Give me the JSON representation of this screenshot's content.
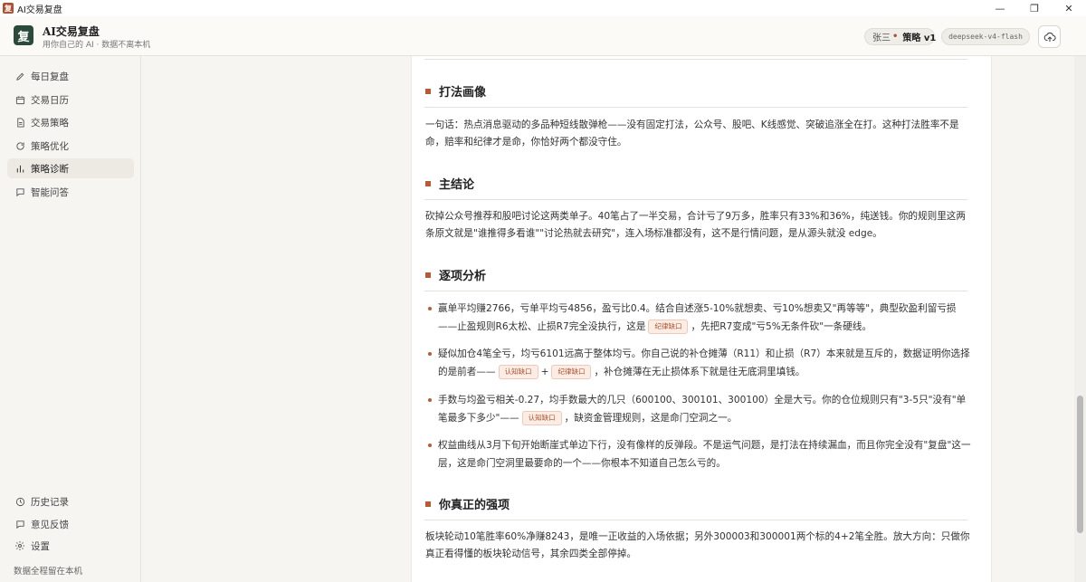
{
  "window": {
    "title": "AI交易复盘",
    "app_icon_glyph": "复",
    "controls": {
      "minimize": "—",
      "maximize": "❐",
      "close": "✕"
    }
  },
  "header": {
    "logo_text": "复",
    "brand_title": "AI交易复盘",
    "brand_subtitle": "用你自己的 AI · 数据不离本机",
    "user_name": "张三",
    "separator": "•",
    "strategy": "策略 v1",
    "model": "deepseek-v4-flash",
    "colors": {
      "logo_bg": "#2c4a3c",
      "accent": "#b85a36"
    }
  },
  "sidebar": {
    "items": [
      {
        "label": "每日复盘",
        "icon": "pencil-icon"
      },
      {
        "label": "交易日历",
        "icon": "calendar-icon"
      },
      {
        "label": "交易策略",
        "icon": "document-icon"
      },
      {
        "label": "策略优化",
        "icon": "refresh-icon"
      },
      {
        "label": "策略诊断",
        "icon": "bar-chart-icon",
        "active": true
      },
      {
        "label": "智能问答",
        "icon": "chat-icon"
      }
    ],
    "bottom_items": [
      {
        "label": "历史记录",
        "icon": "clock-icon"
      },
      {
        "label": "意见反馈",
        "icon": "feedback-icon"
      },
      {
        "label": "设置",
        "icon": "gear-icon"
      }
    ],
    "footer_note": "数据全程留在本机"
  },
  "report": {
    "sections": [
      {
        "heading": "打法画像",
        "text": "一句话：热点消息驱动的多品种短线散弹枪——没有固定打法，公众号、股吧、K线感觉、突破追涨全在打。这种打法胜率不是命，赔率和纪律才是命，你恰好两个都没守住。"
      },
      {
        "heading": "主结论",
        "text": "砍掉公众号推荐和股吧讨论这两类单子。40笔占了一半交易，合计亏了9万多，胜率只有33%和36%，纯送钱。你的规则里这两条原文就是\"谁推得多看谁\"\"讨论热就去研究\"，连入场标准都没有，这不是行情问题，是从源头就没 edge。"
      },
      {
        "heading": "逐项分析",
        "bullets": [
          {
            "before": "赢单平均赚2766，亏单平均亏4856，盈亏比0.4。结合自述涨5-10%就想卖、亏10%想卖又\"再等等\"，典型砍盈利留亏损——止盈规则R6太松、止损R7完全没执行，这是",
            "tag1": "纪律缺口",
            "after": "，先把R7变成\"亏5%无条件砍\"一条硬线。"
          },
          {
            "before": "疑似加仓4笔全亏，均亏6101远高于整体均亏。你自己说的补仓摊薄（R11）和止损（R7）本来就是互斥的，数据证明你选择的是前者——",
            "tag1": "认知缺口",
            "mid": "+",
            "tag2": "纪律缺口",
            "after": "，补仓摊薄在无止损体系下就是往无底洞里填钱。"
          },
          {
            "before": "手数与均盈亏相关-0.27，均手数最大的几只（600100、300101、300100）全是大亏。你的仓位规则只有\"3-5只\"没有\"单笔最多下多少\"——",
            "tag1": "认知缺口",
            "after": "，缺资金管理规则，这是命门空洞之一。"
          },
          {
            "before": "权益曲线从3月下旬开始断崖式单边下行，没有像样的反弹段。不是运气问题，是打法在持续漏血，而且你完全没有\"复盘\"这一层，这是命门空洞里最要命的一个——你根本不知道自己怎么亏的。"
          }
        ]
      },
      {
        "heading": "你真正的强项",
        "text": "板块轮动10笔胜率60%净赚8243，是唯一正收益的入场依据；另外300003和300001两个标的4+2笔全胜。放大方向：只做你真正看得懂的板块轮动信号，其余四类全部停掉。"
      }
    ]
  }
}
